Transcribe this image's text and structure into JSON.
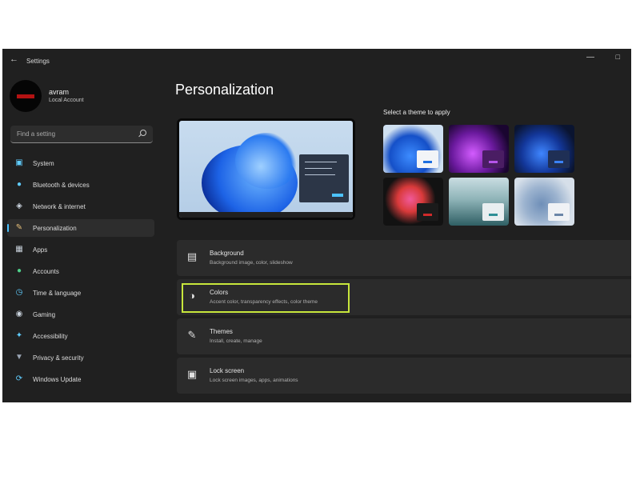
{
  "window": {
    "title": "Settings"
  },
  "user": {
    "name": "avram",
    "account": "Local Account"
  },
  "search": {
    "placeholder": "Find a setting"
  },
  "nav": [
    {
      "label": "System",
      "icon": "monitor-icon"
    },
    {
      "label": "Bluetooth & devices",
      "icon": "bluetooth-icon"
    },
    {
      "label": "Network & internet",
      "icon": "wifi-icon"
    },
    {
      "label": "Personalization",
      "icon": "brush-icon",
      "active": true
    },
    {
      "label": "Apps",
      "icon": "apps-icon"
    },
    {
      "label": "Accounts",
      "icon": "person-icon"
    },
    {
      "label": "Time & language",
      "icon": "clock-globe-icon"
    },
    {
      "label": "Gaming",
      "icon": "gamepad-icon"
    },
    {
      "label": "Accessibility",
      "icon": "accessibility-icon"
    },
    {
      "label": "Privacy & security",
      "icon": "shield-icon"
    },
    {
      "label": "Windows Update",
      "icon": "update-icon"
    }
  ],
  "main": {
    "page_title": "Personalization",
    "themes_label": "Select a theme to apply"
  },
  "rows": [
    {
      "title": "Background",
      "subtitle": "Background image, color, slideshow",
      "icon": "image-icon"
    },
    {
      "title": "Colors",
      "subtitle": "Accent color, transparency effects, color theme",
      "icon": "palette-icon",
      "highlighted": true
    },
    {
      "title": "Themes",
      "subtitle": "Install, create, manage",
      "icon": "pen-icon"
    },
    {
      "title": "Lock screen",
      "subtitle": "Lock screen images, apps, animations",
      "icon": "lock-screen-icon"
    }
  ],
  "colors": {
    "accent": "#4cc2ff",
    "highlight": "#c8e63c"
  }
}
